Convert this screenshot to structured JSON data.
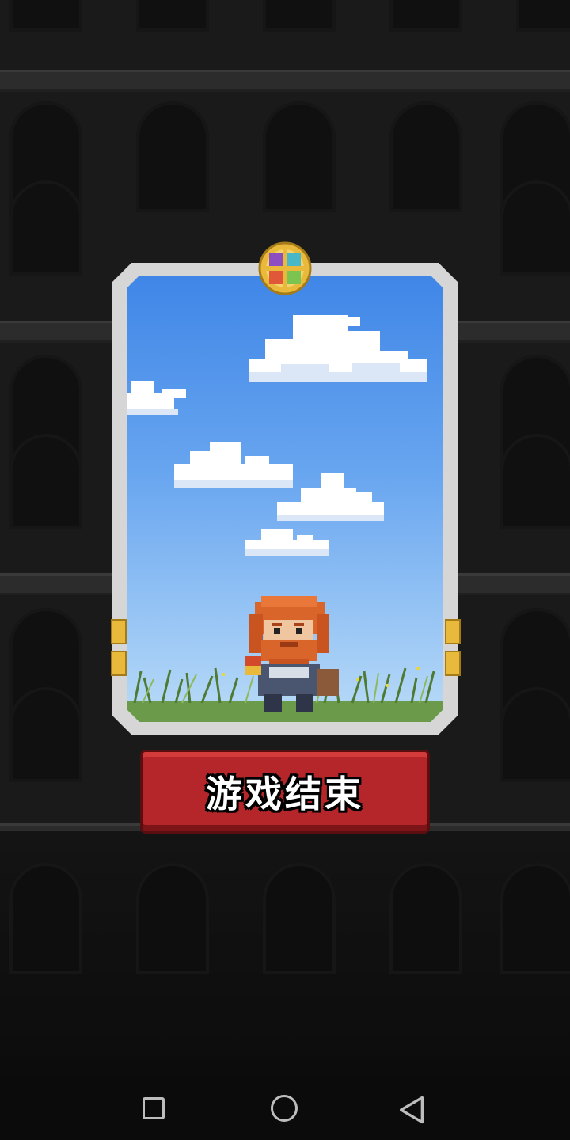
{
  "game_over": {
    "button_label": "游戏结束"
  },
  "hero": {
    "icon": "bearded-warrior-icon"
  },
  "emblem": {
    "icon": "four-gem-emblem-icon"
  },
  "navigation": {
    "recent_apps_icon": "square-icon",
    "home_icon": "circle-icon",
    "back_icon": "triangle-back-icon"
  },
  "colors": {
    "button": "#b5262a",
    "sky_top": "#3f86e7",
    "sky_bottom": "#b9dbf7",
    "frame": "#d6d6d6",
    "gold": "#e8b93a"
  }
}
